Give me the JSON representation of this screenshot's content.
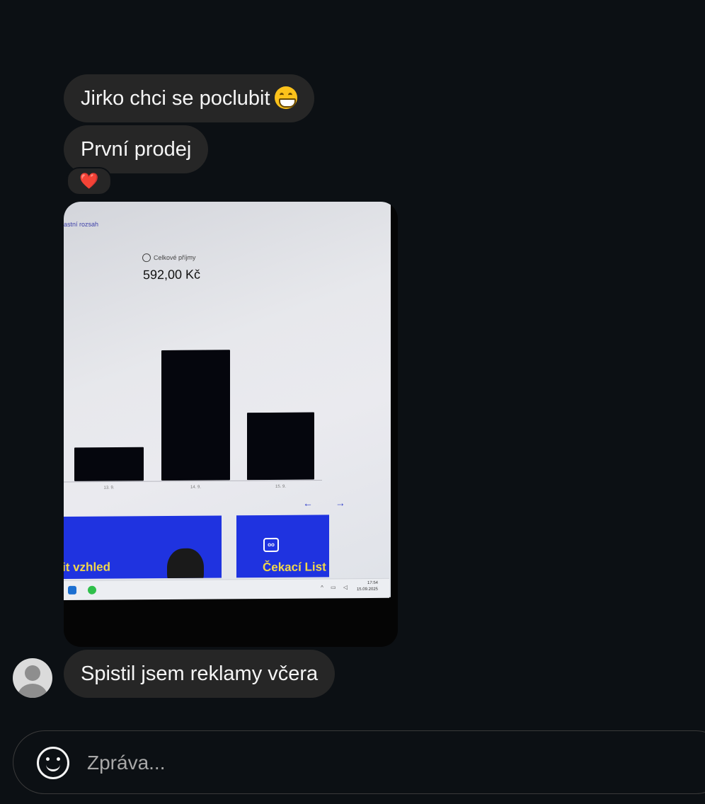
{
  "thread": {
    "messages": [
      {
        "text": "Jirko chci se poclubit",
        "emoji": "grinning-face"
      },
      {
        "text": "První prodej",
        "reaction": "❤️"
      },
      {
        "type": "image"
      },
      {
        "text": "Spistil jsem reklamy včera"
      }
    ]
  },
  "photo": {
    "range_link": "astní rozsah",
    "income_label": "Celkové příjmy",
    "income_value": "592,00 Kč",
    "nav_arrows": "← →",
    "promo_left": "it vzhled",
    "promo_right": "Čekací List",
    "taskbar_time": "17:54",
    "taskbar_date": "15.09.2025"
  },
  "chart_data": {
    "type": "bar",
    "categories": [
      "13. 9.",
      "14. 9.",
      "15. 9."
    ],
    "values": [
      80,
      310,
      160
    ],
    "title": "",
    "xlabel": "",
    "ylabel": "",
    "bar_color": "#05060d"
  },
  "composer": {
    "placeholder": "Zpráva..."
  }
}
